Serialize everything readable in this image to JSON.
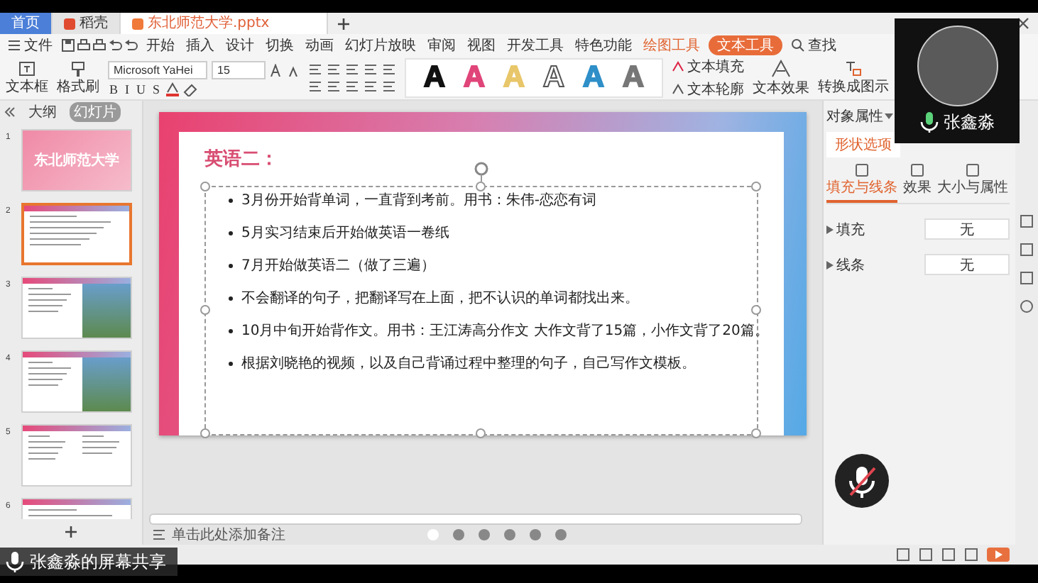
{
  "window_tabs": [
    {
      "label": "首页",
      "kind": "home",
      "selected": false
    },
    {
      "label": "稻壳",
      "kind": "app",
      "selected": false
    },
    {
      "label": "东北师范大学.pptx",
      "kind": "doc",
      "selected": true
    }
  ],
  "menu": {
    "file": "文件",
    "items": [
      {
        "label": "开始",
        "kind": "menu",
        "selected": false
      },
      {
        "label": "插入",
        "kind": "menu",
        "selected": false
      },
      {
        "label": "设计",
        "kind": "menu",
        "selected": false
      },
      {
        "label": "切换",
        "kind": "menu",
        "selected": false
      },
      {
        "label": "动画",
        "kind": "menu",
        "selected": false
      },
      {
        "label": "幻灯片放映",
        "kind": "menu",
        "selected": false
      },
      {
        "label": "审阅",
        "kind": "menu",
        "selected": false
      },
      {
        "label": "视图",
        "kind": "menu",
        "selected": false
      },
      {
        "label": "开发工具",
        "kind": "menu",
        "selected": false
      },
      {
        "label": "特色功能",
        "kind": "menu",
        "selected": false
      },
      {
        "label": "绘图工具",
        "kind": "context",
        "selected": false
      },
      {
        "label": "文本工具",
        "kind": "context",
        "selected": true
      }
    ],
    "search": "查找"
  },
  "ribbon": {
    "textbox": "文本框",
    "format_painter": "格式刷",
    "font": "Microsoft YaHei",
    "size": "15",
    "format_buttons": [
      "B",
      "I",
      "U",
      "S"
    ],
    "wordart": [
      {
        "label": "A",
        "color": "#111111"
      },
      {
        "label": "A",
        "color": "#e0457a"
      },
      {
        "label": "A",
        "color": "#e8c66a"
      },
      {
        "label": "A",
        "color": "#ffffff"
      },
      {
        "label": "A",
        "color": "#2f8fc8"
      },
      {
        "label": "A",
        "color": "#777777"
      }
    ],
    "text_fill": "文本填充",
    "text_outline": "文本轮廓",
    "text_effect": "文本效果",
    "convert": "转换成图示"
  },
  "sidebar": {
    "tabs": [
      {
        "label": "大纲",
        "selected": false
      },
      {
        "label": "幻灯片",
        "selected": true
      }
    ],
    "slides": [
      {
        "number": "1",
        "kind": "title",
        "title": "东北师范大学",
        "selected": false
      },
      {
        "number": "2",
        "kind": "text",
        "selected": true
      },
      {
        "number": "3",
        "kind": "photo",
        "selected": false
      },
      {
        "number": "4",
        "kind": "photo",
        "selected": false
      },
      {
        "number": "5",
        "kind": "columns",
        "selected": false
      },
      {
        "number": "6",
        "kind": "text",
        "selected": false
      }
    ]
  },
  "slide": {
    "title": "英语二：",
    "bullets": [
      "3月份开始背单词，一直背到考前。用书：朱伟-恋恋有词",
      "5月实习结束后开始做英语一卷纸",
      "7月开始做英语二（做了三遍）",
      "不会翻译的句子，把翻译写在上面，把不认识的单词都找出来。",
      "10月中旬开始背作文。用书：王江涛高分作文  大作文背了15篇，小作文背了20篇。",
      "根据刘晓艳的视频，以及自己背诵过程中整理的句子，自己写作文模板。"
    ]
  },
  "notes": {
    "placeholder": "单击此处添加备注"
  },
  "pager": [
    {
      "selected": true
    },
    {
      "selected": false
    },
    {
      "selected": false
    },
    {
      "selected": false
    },
    {
      "selected": false
    },
    {
      "selected": false
    }
  ],
  "props": {
    "title": "对象属性",
    "tab": "形状选项",
    "subtabs": [
      {
        "label": "填充与线条",
        "selected": true
      },
      {
        "label": "效果",
        "selected": false
      },
      {
        "label": "大小与属性",
        "selected": false
      }
    ],
    "rows": [
      {
        "label": "填充",
        "value": "无"
      },
      {
        "label": "线条",
        "value": "无"
      }
    ]
  },
  "call": {
    "speaker": "张鑫淼",
    "share_banner": "张鑫淼的屏幕共享",
    "muted": true
  }
}
